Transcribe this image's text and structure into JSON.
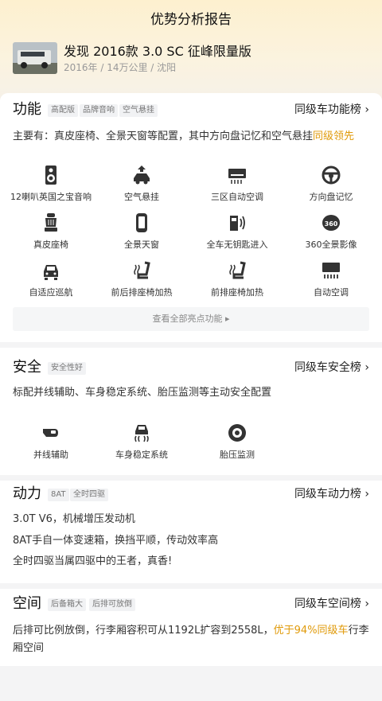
{
  "header": {
    "title": "优势分析报告",
    "car_name": "发现 2016款 3.0 SC 征峰限量版",
    "meta": "2016年 / 14万公里 / 沈阳"
  },
  "function": {
    "title": "功能",
    "tags": [
      "高配版",
      "品牌音响",
      "空气悬挂"
    ],
    "rank_link": "同级车功能榜 ›",
    "desc_main": "主要有：真皮座椅、全景天窗等配置，其中方向盘记忆和空气悬挂",
    "desc_hl": "同级领先",
    "features": [
      {
        "label": "12喇叭英国之宝音响",
        "icon": "speaker-icon"
      },
      {
        "label": "空气悬挂",
        "icon": "air-suspension-icon"
      },
      {
        "label": "三区自动空调",
        "icon": "ac-icon"
      },
      {
        "label": "方向盘记忆",
        "icon": "steering-wheel-icon"
      },
      {
        "label": "真皮座椅",
        "icon": "leather-seat-icon"
      },
      {
        "label": "全景天窗",
        "icon": "sunroof-icon"
      },
      {
        "label": "全车无钥匙进入",
        "icon": "keyless-entry-icon"
      },
      {
        "label": "360全景影像",
        "icon": "camera-360-icon"
      },
      {
        "label": "自适应巡航",
        "icon": "adaptive-cruise-icon"
      },
      {
        "label": "前后排座椅加热",
        "icon": "seat-heating-icon"
      },
      {
        "label": "前排座椅加热",
        "icon": "front-seat-heating-icon"
      },
      {
        "label": "自动空调",
        "icon": "auto-ac-icon"
      }
    ],
    "more": "查看全部亮点功能 ▸"
  },
  "safety": {
    "title": "安全",
    "tags": [
      "安全性好"
    ],
    "rank_link": "同级车安全榜 ›",
    "desc": "标配并线辅助、车身稳定系统、胎压监测等主动安全配置",
    "features": [
      {
        "label": "并线辅助",
        "icon": "lane-assist-icon"
      },
      {
        "label": "车身稳定系统",
        "icon": "stability-control-icon"
      },
      {
        "label": "胎压监测",
        "icon": "tire-pressure-icon"
      }
    ]
  },
  "power": {
    "title": "动力",
    "tags": [
      "8AT",
      "全时四驱"
    ],
    "rank_link": "同级车动力榜 ›",
    "lines": [
      "3.0T V6，机械增压发动机",
      "8AT手自一体变速箱，换挡平顺，传动效率高",
      "全时四驱当属四驱中的王者，真香!"
    ]
  },
  "space": {
    "title": "空间",
    "tags": [
      "后备箱大",
      "后排可放倒"
    ],
    "rank_link": "同级车空间榜 ›",
    "desc_main": "后排可比例放倒，行李厢容积可从1192L扩容到2558L，",
    "desc_hl": "优于94%同级车",
    "desc_tail": "行李厢空间"
  },
  "colors": {
    "highlight": "#e09a0a",
    "header_bg": "#fdf0cf",
    "icon": "#333333"
  }
}
